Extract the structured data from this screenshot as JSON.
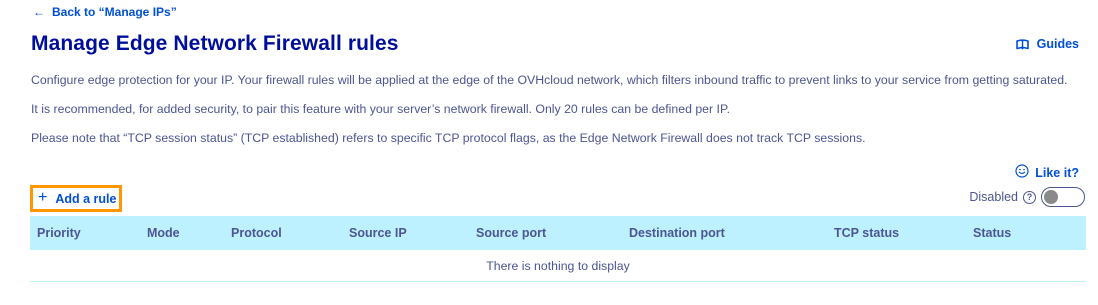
{
  "back_link": {
    "arrow": "←",
    "label": "Back to “Manage IPs”"
  },
  "page_title": "Manage Edge Network Firewall rules",
  "guides": {
    "label": "Guides",
    "icon": "book-icon"
  },
  "descriptions": [
    "Configure edge protection for your IP. Your firewall rules will be applied at the edge of the OVHcloud network, which filters inbound traffic to prevent links to your service from getting saturated.",
    "It is recommended, for added security, to pair this feature with your server’s network firewall. Only 20 rules can be defined per IP.",
    "Please note that “TCP session status” (TCP established) refers to specific TCP protocol flags, as the Edge Network Firewall does not track TCP sessions."
  ],
  "like_it": {
    "label": "Like it?",
    "icon": "smiley-icon"
  },
  "add_rule": {
    "plus": "+",
    "label": "Add a rule"
  },
  "firewall_toggle": {
    "label": "Disabled",
    "help": "?",
    "enabled": false
  },
  "table": {
    "columns": [
      "Priority",
      "Mode",
      "Protocol",
      "Source IP",
      "Source port",
      "Destination port",
      "TCP status",
      "Status"
    ],
    "empty_message": "There is nothing to display"
  },
  "colors": {
    "link": "#0050d7",
    "title": "#000e9c",
    "text": "#4d5592",
    "table_header_bg": "#bef1ff",
    "highlight_border": "#ff9800"
  }
}
